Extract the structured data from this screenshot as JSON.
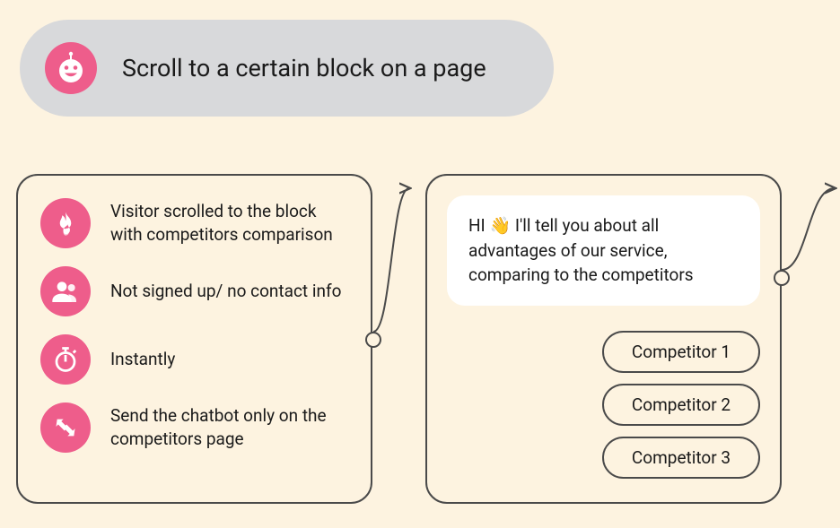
{
  "header": {
    "title": "Scroll to a certain block on a page",
    "icon": "bot-icon"
  },
  "conditions": [
    {
      "icon": "flame-icon",
      "text": "Visitor scrolled to the block with competitors comparison"
    },
    {
      "icon": "users-icon",
      "text": "Not signed up/ no contact info"
    },
    {
      "icon": "stopwatch-icon",
      "text": "Instantly"
    },
    {
      "icon": "arrows-icon",
      "text": "Send the chatbot only on the competitors page"
    }
  ],
  "chat": {
    "message_prefix": "HI ",
    "wave_emoji": "👋",
    "message_suffix": " I'll tell you about all advantages of our service, comparing to the competitors",
    "options": [
      "Competitor 1",
      "Competitor 2",
      "Competitor 3"
    ]
  }
}
